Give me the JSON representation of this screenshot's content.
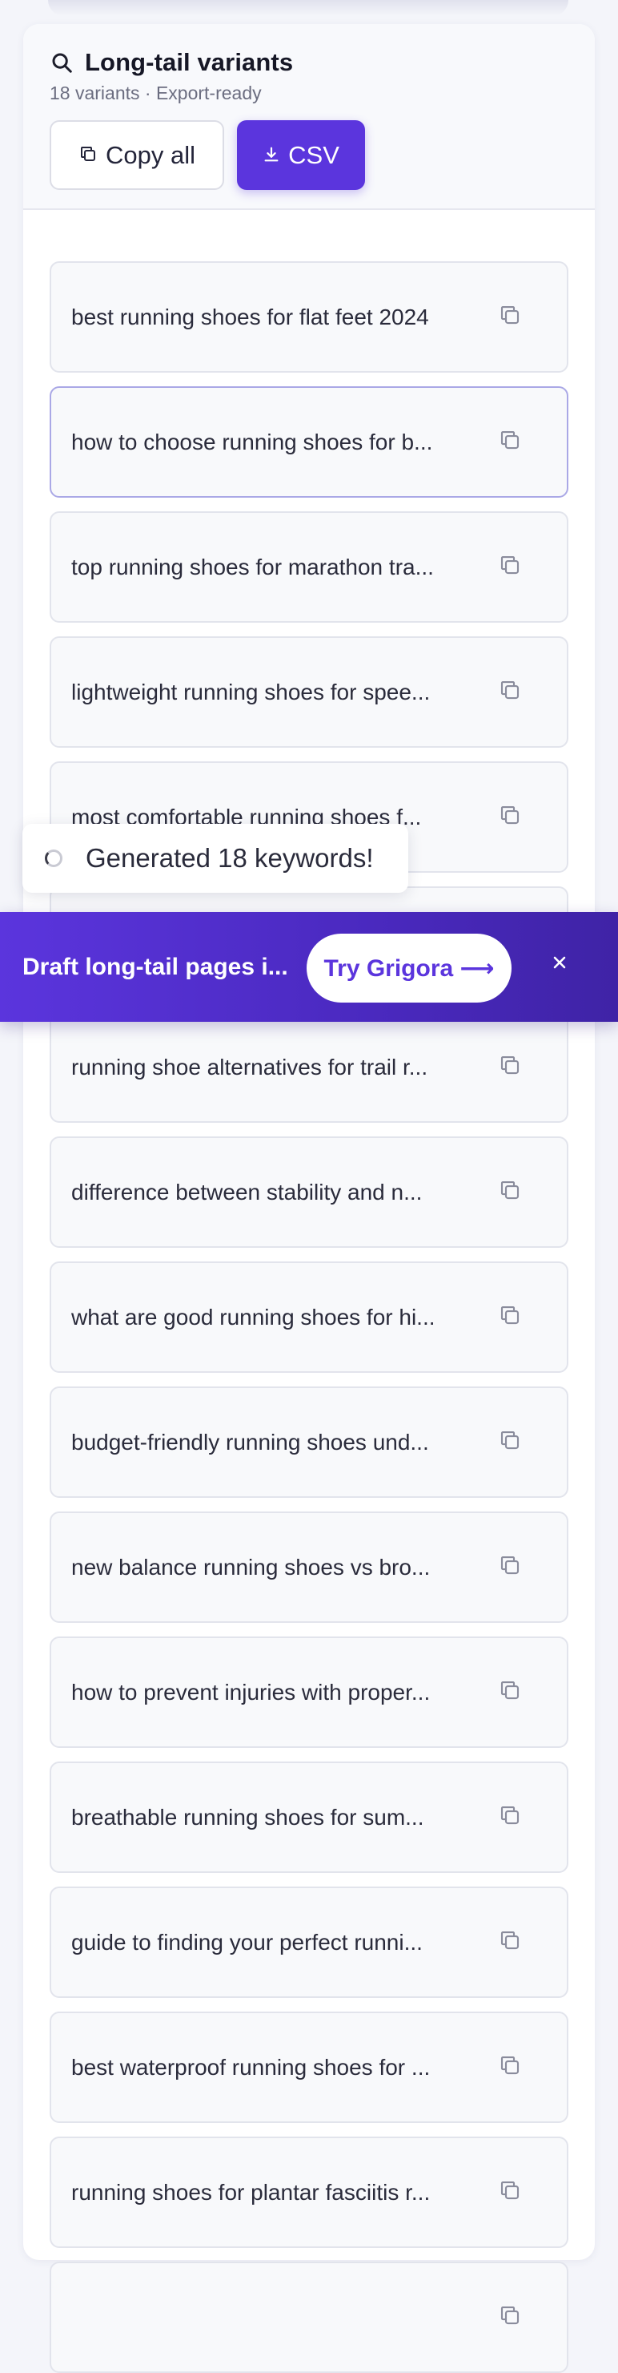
{
  "panel": {
    "title": "Long-tail variants",
    "subtitle": "18 variants · Export-ready",
    "search_icon": "search-icon",
    "copy_all_label": "Copy all",
    "csv_label": "CSV",
    "accent_color": "#5b35dd"
  },
  "keywords": [
    "best running shoes for flat feet 2024",
    "how to choose running shoes for b...",
    "top running shoes for marathon tra...",
    "lightweight running shoes for spee...",
    "most comfortable running shoes f...",
    "",
    "running shoe alternatives for trail r...",
    "difference between stability and n...",
    "what are good running shoes for hi...",
    "budget-friendly running shoes und...",
    "new balance running shoes vs bro...",
    "how to prevent injuries with proper...",
    "breathable running shoes for sum...",
    "guide to finding your perfect runni...",
    "best waterproof running shoes for ...",
    "running shoes for plantar fasciitis r...",
    ""
  ],
  "toast": {
    "message": "Generated 18 keywords!"
  },
  "promo_banner": {
    "text": "Draft long-tail pages i...",
    "cta_label": "Try Grigora ⟶",
    "close_label": "×"
  }
}
